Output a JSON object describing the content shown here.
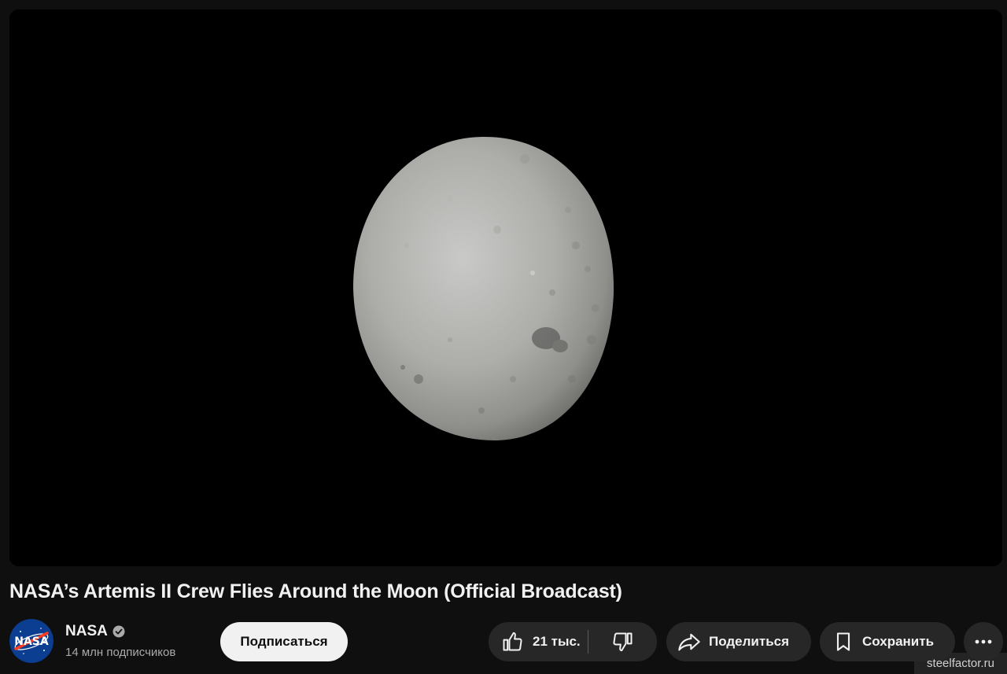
{
  "video": {
    "title": "NASA’s Artemis II Crew Flies Around the Moon (Official Broadcast)"
  },
  "channel": {
    "name": "NASA",
    "subscribers": "14 млн подписчиков",
    "logo_text": "NASA",
    "verified": true
  },
  "actions": {
    "subscribe_label": "Подписаться",
    "likes_count": "21 тыс.",
    "share_label": "Поделиться",
    "save_label": "Сохранить"
  },
  "watermark": "steelfactor.ru",
  "colors": {
    "background": "#0f0f0f",
    "pill": "#272727",
    "subscribe_bg": "#f1f1f1",
    "nasa_blue": "#0b3d91",
    "nasa_red": "#fc3d21"
  }
}
